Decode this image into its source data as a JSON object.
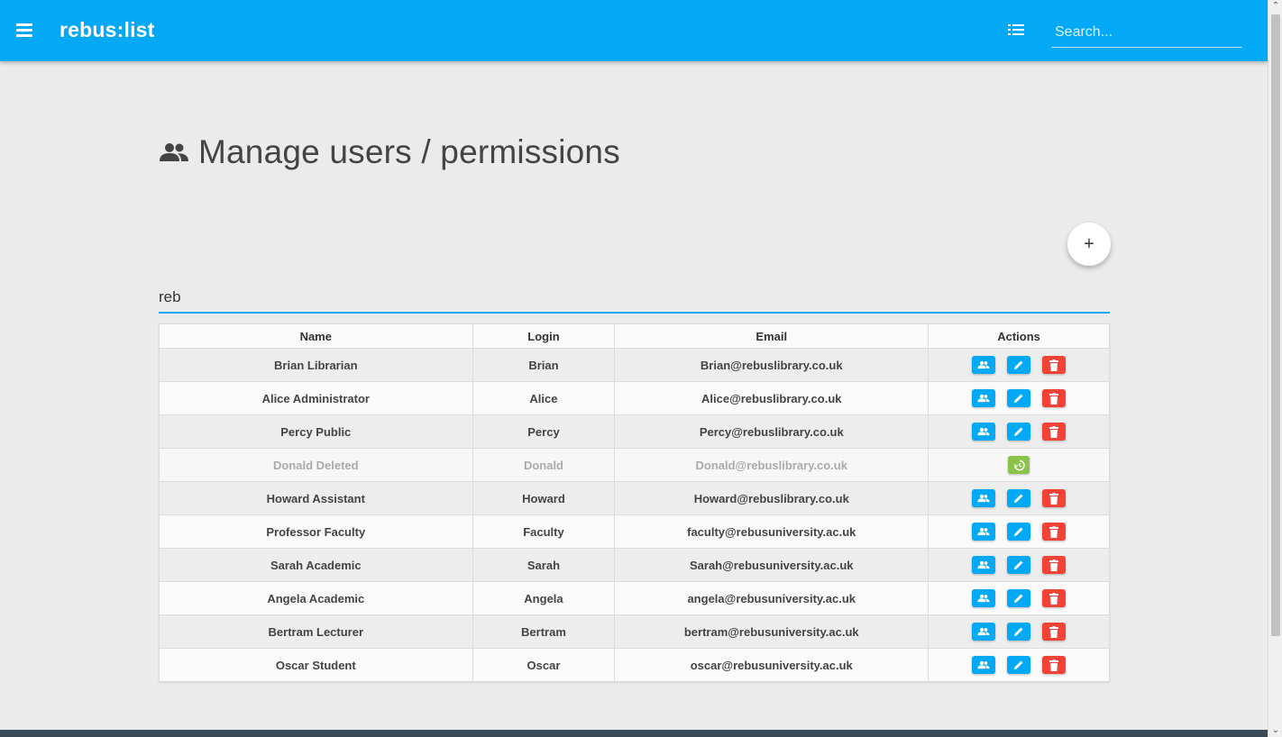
{
  "app": {
    "title": "rebus:list",
    "menu_icon": "hamburger-menu-icon",
    "list_icon": "list-icon",
    "search_placeholder": "Search..."
  },
  "page": {
    "heading": "Manage users / permissions",
    "heading_icon": "people-icon",
    "add_button_label": "+",
    "filter_value": "reb"
  },
  "colors": {
    "primary": "#03a9f4",
    "danger": "#f44336",
    "success": "#8bc34a",
    "background": "#ebebeb"
  },
  "table": {
    "headers": [
      "Name",
      "Login",
      "Email",
      "Actions"
    ],
    "rows": [
      {
        "name": "Brian Librarian",
        "login": "Brian",
        "email": "Brian@rebuslibrary.co.uk",
        "deleted": false
      },
      {
        "name": "Alice Administrator",
        "login": "Alice",
        "email": "Alice@rebuslibrary.co.uk",
        "deleted": false
      },
      {
        "name": "Percy Public",
        "login": "Percy",
        "email": "Percy@rebuslibrary.co.uk",
        "deleted": false
      },
      {
        "name": "Donald Deleted",
        "login": "Donald",
        "email": "Donald@rebuslibrary.co.uk",
        "deleted": true
      },
      {
        "name": "Howard Assistant",
        "login": "Howard",
        "email": "Howard@rebuslibrary.co.uk",
        "deleted": false
      },
      {
        "name": "Professor Faculty",
        "login": "Faculty",
        "email": "faculty@rebusuniversity.ac.uk",
        "deleted": false
      },
      {
        "name": "Sarah Academic",
        "login": "Sarah",
        "email": "Sarah@rebusuniversity.ac.uk",
        "deleted": false
      },
      {
        "name": "Angela Academic",
        "login": "Angela",
        "email": "angela@rebusuniversity.ac.uk",
        "deleted": false
      },
      {
        "name": "Bertram Lecturer",
        "login": "Bertram",
        "email": "bertram@rebusuniversity.ac.uk",
        "deleted": false
      },
      {
        "name": "Oscar Student",
        "login": "Oscar",
        "email": "oscar@rebusuniversity.ac.uk",
        "deleted": false
      }
    ],
    "action_icons": {
      "permissions": "people-icon",
      "edit": "pencil-icon",
      "delete": "trash-icon",
      "restore": "restore-history-icon"
    }
  }
}
